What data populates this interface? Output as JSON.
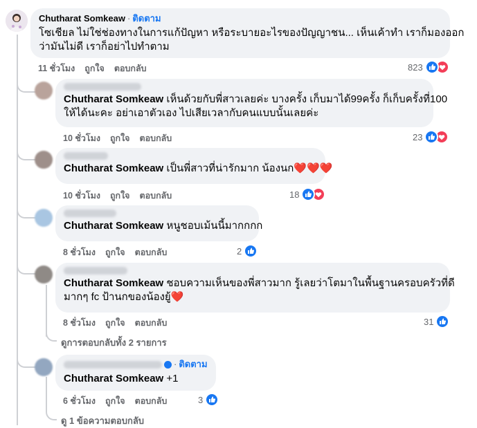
{
  "main": {
    "name": "Chutharat Somkeaw",
    "follow": "ติดตาม",
    "text_line1": "โซเชียล ไม่ใช่ช่องทางในการแก้ปัญหา หรือระบายอะไรของปัญญาชน... เห็นเค้าทำ เราก็มองออก",
    "text_line2": "ว่ามันไม่ดี เราก็อย่าไปทำตาม",
    "time": "11 ชั่วโมง",
    "like": "ถูกใจ",
    "reply": "ตอบกลับ",
    "reactions": "823"
  },
  "replies": [
    {
      "mention": "Chutharat Somkeaw",
      "text_line1": " เห็นด้วยกับพี่สาวเลยค่ะ บางครั้ง เก็บมาได้99ครั้ง ก็เก็บครั้งที่100",
      "text_line2": "ให้ได้นะคะ อย่าเอาตัวเอง ไปเสียเวลากับคนแบบนั้นเลยค่ะ",
      "time": "10 ชั่วโมง",
      "like": "ถูกใจ",
      "reply": "ตอบกลับ",
      "reactions": "23"
    },
    {
      "mention": "Chutharat Somkeaw",
      "text_line1": " เป็นพี่สาวที่น่ารักมาก น้องนก",
      "hearts": "❤️❤️❤️",
      "time": "10 ชั่วโมง",
      "like": "ถูกใจ",
      "reply": "ตอบกลับ",
      "reactions": "18"
    },
    {
      "mention": "Chutharat Somkeaw",
      "text_line1": " หนูชอบเม้นนี้มากกกก",
      "time": "8 ชั่วโมง",
      "like": "ถูกใจ",
      "reply": "ตอบกลับ",
      "reactions": "2"
    },
    {
      "mention": "Chutharat Somkeaw",
      "text_line1": " ชอบความเห็นของพี่สาวมาก รู้เลยว่าโตมาในพื้นฐานครอบครัวที่ดี",
      "text_line2": "มากๆ fc ป้านกของน้องยู้",
      "hearts": "❤️",
      "time": "8 ชั่วโมง",
      "like": "ถูกใจ",
      "reply": "ตอบกลับ",
      "reactions": "31",
      "more": "ดูการตอบกลับทั้ง 2 รายการ"
    },
    {
      "follow": "ติดตาม",
      "mention": "Chutharat Somkeaw",
      "text_line1": " +1",
      "time": "6 ชั่วโมง",
      "like": "ถูกใจ",
      "reply": "ตอบกลับ",
      "reactions": "3",
      "more": "ดู 1 ข้อความตอบกลับ"
    }
  ],
  "icons": {
    "like": "like-icon",
    "love": "love-icon"
  },
  "colors": {
    "bubble": "#f0f2f5",
    "link": "#1877f2",
    "meta": "#65676b",
    "love": "#f33e58"
  }
}
